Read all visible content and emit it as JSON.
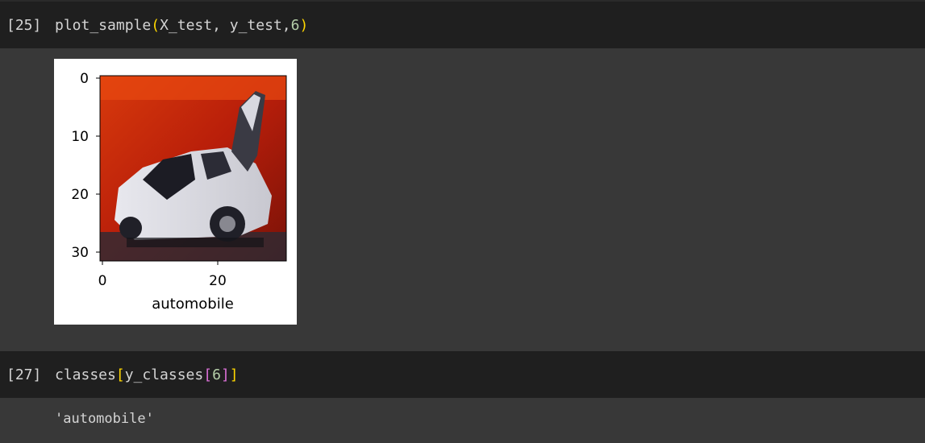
{
  "cells": [
    {
      "exec_count": "[25]",
      "code": {
        "func": "plot_sample",
        "open": "(",
        "args": "X_test, y_test,",
        "num": "6",
        "close": ")"
      },
      "output": {
        "type": "image-plot",
        "y_ticks": [
          "0",
          "10",
          "20",
          "30"
        ],
        "x_ticks": [
          "0",
          "20"
        ],
        "xlabel": "automobile"
      }
    },
    {
      "exec_count": "[27]",
      "code": {
        "func": "classes",
        "open1": "[",
        "inner": "y_classes",
        "open2": "[",
        "num": "6",
        "close2": "]",
        "close1": "]"
      },
      "output": {
        "type": "text",
        "value": "'automobile'"
      }
    }
  ],
  "colors": {
    "background": "#383838",
    "input_bg": "#1f1f1f",
    "text": "#d4d4d4",
    "bracket_level1": "#ffd700",
    "bracket_level2": "#da70d6",
    "number": "#b5cea8"
  }
}
